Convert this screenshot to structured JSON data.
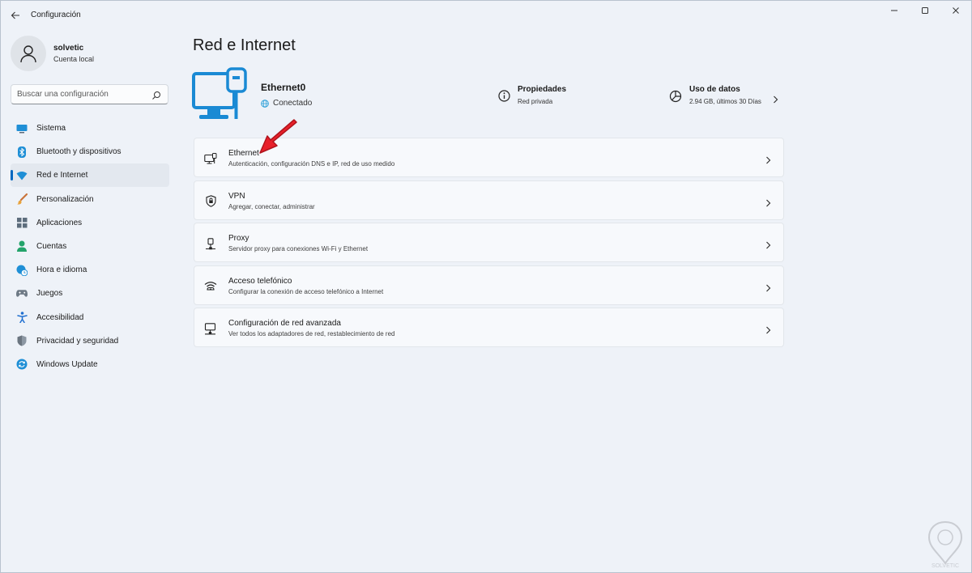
{
  "titlebar": {
    "app_title": "Configuración"
  },
  "profile": {
    "name": "solvetic",
    "account_type": "Cuenta local"
  },
  "search": {
    "placeholder": "Buscar una configuración"
  },
  "sidebar": {
    "items": [
      {
        "label": "Sistema",
        "icon": "monitor-icon"
      },
      {
        "label": "Bluetooth y dispositivos",
        "icon": "bluetooth-icon"
      },
      {
        "label": "Red e Internet",
        "icon": "wifi-icon",
        "active": true
      },
      {
        "label": "Personalización",
        "icon": "brush-icon"
      },
      {
        "label": "Aplicaciones",
        "icon": "apps-icon"
      },
      {
        "label": "Cuentas",
        "icon": "person-icon"
      },
      {
        "label": "Hora e idioma",
        "icon": "globe-clock-icon"
      },
      {
        "label": "Juegos",
        "icon": "gamepad-icon"
      },
      {
        "label": "Accesibilidad",
        "icon": "accessibility-icon"
      },
      {
        "label": "Privacidad y seguridad",
        "icon": "shield-icon"
      },
      {
        "label": "Windows Update",
        "icon": "update-icon"
      }
    ]
  },
  "main": {
    "title": "Red e Internet",
    "connection": {
      "name": "Ethernet0",
      "status": "Conectado"
    },
    "properties": {
      "title": "Propiedades",
      "subtitle": "Red privada"
    },
    "data_usage": {
      "title": "Uso de datos",
      "subtitle": "2.94 GB, últimos 30 Días"
    },
    "cards": [
      {
        "title": "Ethernet",
        "subtitle": "Autenticación, configuración DNS e IP, red de uso medido",
        "icon": "ethernet-icon"
      },
      {
        "title": "VPN",
        "subtitle": "Agregar, conectar, administrar",
        "icon": "vpn-shield-icon"
      },
      {
        "title": "Proxy",
        "subtitle": "Servidor proxy para conexiones Wi-Fi y Ethernet",
        "icon": "proxy-icon"
      },
      {
        "title": "Acceso telefónico",
        "subtitle": "Configurar la conexión de acceso telefónico a Internet",
        "icon": "dialup-icon"
      },
      {
        "title": "Configuración de red avanzada",
        "subtitle": "Ver todos los adaptadores de red, restablecimiento de red",
        "icon": "network-adapter-icon"
      }
    ]
  },
  "watermark": {
    "text": "SOLVETIC"
  },
  "colors": {
    "accent": "#0067c0",
    "hero_blue": "#1a8ad4",
    "arrow_red": "#e8202a",
    "background": "#eef2f8"
  }
}
